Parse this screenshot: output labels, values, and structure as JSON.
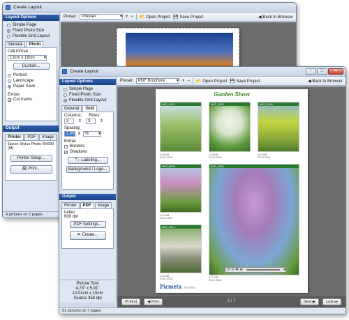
{
  "back_window": {
    "title": "Create Layout",
    "layout_options_header": "Layout Options",
    "layout_modes": [
      "Simple Page",
      "Fixed Photo Size",
      "Flexible Grid Layout"
    ],
    "tabs": [
      "General",
      "Photo"
    ],
    "cell_format_label": "Cell format",
    "cell_format_value": "13cm x 18cm",
    "custom_button": "Custom...",
    "orientations": [
      "Portrait",
      "Landscape",
      "Paper Save"
    ],
    "extras_label": "Extras",
    "cut_marks_label": "Cut marks",
    "output_header": "Output",
    "output_tabs": [
      "Printer",
      "PDF",
      "Image"
    ],
    "printer_name": "Epson Stylus Photo RX600 (M)",
    "printer_setup_button": "Printer Setup...",
    "print_button": "Print...",
    "status": "4 pictures on 2 pages",
    "toolbar": {
      "preset_label": "Preset:",
      "preset_value": "<None>",
      "open_project": "Open Project",
      "save_project": "Save Project",
      "back_to_browser": "Back to Browser"
    }
  },
  "front_window": {
    "title": "Create Layout",
    "layout_options_header": "Layout Options",
    "layout_modes": [
      "Simple Page",
      "Fixed Photo Size",
      "Flexible Grid Layout"
    ],
    "tabs": [
      "General",
      "Grid"
    ],
    "columns_label": "Columns:",
    "rows_label": "Rows:",
    "columns_value": "3",
    "rows_value": "3",
    "spacing_label": "Spacing:",
    "spacing_value": "1,00",
    "spacing_unit": "%",
    "extras_label": "Extras",
    "borders_label": "Borders",
    "shadows_label": "Shadows",
    "labeling_button": "Labeling...",
    "background_button": "Background / Logo...",
    "output_header": "Output",
    "output_tabs": [
      "Printer",
      "PDF",
      "Image"
    ],
    "pdf_paper": "Letter",
    "pdf_dpi": "600 dpi",
    "pdf_settings_button": "PDF Settings...",
    "create_button": "Create...",
    "picture_size_label": "Picture Size",
    "picture_size_in": "4,73\" x 5,91\"",
    "picture_size_cm": "12,01cm x 15cm",
    "source_dpi": "Source 358 dpi",
    "status": "51 pictures on 7 pages",
    "toolbar": {
      "preset_label": "Preset:",
      "preset_value": "PDF Brochure",
      "open_project": "Open Project",
      "save_project": "Save Project",
      "back_to_browser": "Back to Browser"
    },
    "page_title": "Garden Show",
    "brand_logo": "Picmeta",
    "brand_suffix": "Systems",
    "photos": [
      {
        "label": "IMG_0012",
        "meta1": "4,00 MB",
        "meta2": "21.01.2016"
      },
      {
        "label": "IMG_0013",
        "meta1": "3,93 MB",
        "meta2": "21.01.2016"
      },
      {
        "label": "IMG_0014",
        "meta1": "3,63 MB",
        "meta2": "21.01.2016"
      },
      {
        "label": "IMG_0015",
        "meta1": "4,27 MB",
        "meta2": "21.01.2016"
      },
      {
        "label": "IMG_0016",
        "meta1": "4,77 MB",
        "meta2": "20.01.2016"
      },
      {
        "label": "IMG_0017",
        "meta1": "4,41 MB",
        "meta2": "21.01.2016"
      }
    ],
    "nav": {
      "first": "First",
      "prev": "Prev",
      "page_indicator": "2 / 7",
      "next": "Next",
      "last": "Last"
    }
  },
  "colors": {
    "panel_header": "#1b4488",
    "photo_header": "#2a7a32",
    "title_green": "#3a8a2a"
  }
}
